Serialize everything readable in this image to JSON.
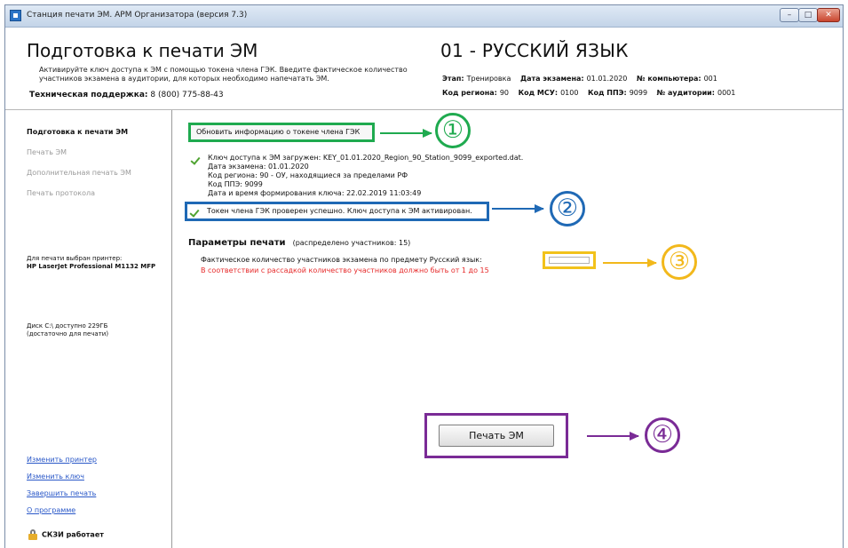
{
  "window": {
    "title": "Станция печати ЭМ. АРМ Организатора (версия 7.3)",
    "controls": {
      "minimize": "–",
      "maximize": "□",
      "close": "✕"
    }
  },
  "header": {
    "title": "Подготовка к печати ЭМ",
    "description": "Активируйте ключ доступа к ЭМ с помощью токена члена ГЭК. Введите фактическое количество участников экзамена в аудитории, для которых необходимо напечатать ЭМ.",
    "support_label": "Техническая поддержка:",
    "support_phone": "8 (800) 775-88-43",
    "subject": "01 - РУССКИЙ ЯЗЫК",
    "stage_label": "Этап:",
    "stage_value": "Тренировка",
    "exam_date_label": "Дата экзамена:",
    "exam_date_value": "01.01.2020",
    "computer_label": "№ компьютера:",
    "computer_value": "001",
    "region_label": "Код региона:",
    "region_value": "90",
    "msu_label": "Код МСУ:",
    "msu_value": "0100",
    "ppe_label": "Код ППЭ:",
    "ppe_value": "9099",
    "auditorium_label": "№ аудитории:",
    "auditorium_value": "0001"
  },
  "sidebar": {
    "items": [
      {
        "label": "Подготовка к печати ЭМ",
        "state": "active"
      },
      {
        "label": "Печать ЭМ",
        "state": "disabled"
      },
      {
        "label": "Дополнительная печать ЭМ",
        "state": "disabled"
      },
      {
        "label": "Печать протокола",
        "state": "disabled"
      }
    ],
    "printer_label": "Для печати выбран принтер:",
    "printer_name": "HP LaserJet Professional M1132 MFP",
    "disk_line1": "Диск C:\\ доступно 229ГБ",
    "disk_line2": "(достаточно для печати)",
    "links": [
      "Изменить принтер",
      "Изменить ключ",
      "Завершить печать",
      "О программе"
    ],
    "crypto_status": "СКЗИ работает"
  },
  "main": {
    "update_token_button": "Обновить информацию о токене члена ГЭК",
    "key_loaded": "Ключ доступа к ЭМ загружен: KEY_01.01.2020_Region_90_Station_9099_exported.dat.",
    "key_exam_date": "Дата экзамена: 01.01.2020",
    "key_region": "Код региона: 90 - ОУ, находящиеся за пределами РФ",
    "key_ppe": "Код ППЭ: 9099",
    "key_created": "Дата и время формирования ключа: 22.02.2019 11:03:49",
    "token_status": "Токен члена ГЭК проверен успешно. Ключ доступа к ЭМ активирован.",
    "params_title": "Параметры печати",
    "params_note": "(распределено участников: 15)",
    "actual_count_label": "Фактическое количество участников экзамена по предмету Русский язык:",
    "actual_count_value": "",
    "warning": "В соответствии с рассадкой количество участников должно быть от 1 до 15",
    "print_button": "Печать ЭМ"
  },
  "annotations": {
    "steps": [
      "①",
      "②",
      "③",
      "④"
    ],
    "colors": {
      "step1": "#1faa4f",
      "step2": "#1f69b5",
      "step3": "#f2b81b",
      "step4": "#7a2b96",
      "warning": "#e62a2a",
      "link": "#2a58c8"
    }
  }
}
